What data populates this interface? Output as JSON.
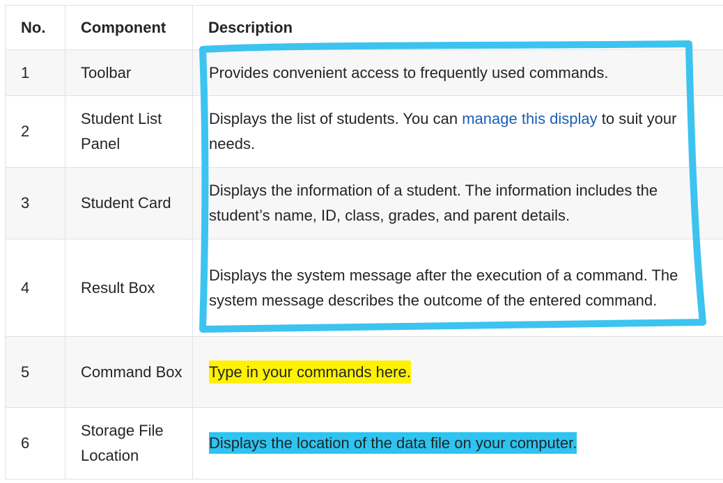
{
  "table": {
    "headers": [
      "No.",
      "Component",
      "Description"
    ],
    "rows": [
      {
        "no": "1",
        "component": "Toolbar",
        "description": "Provides convenient access to frequently used commands."
      },
      {
        "no": "2",
        "component": "Student List Panel",
        "description_before": "Displays the list of students. You can ",
        "link": "manage this display",
        "description_after": " to suit your needs."
      },
      {
        "no": "3",
        "component": "Student Card",
        "description": "Displays the information of a student. The information includes the student’s name, ID, class, grades, and parent details."
      },
      {
        "no": "4",
        "component": "Result Box",
        "description": "Displays the system message after the execution of a command. The system message describes the outcome of the entered command."
      },
      {
        "no": "5",
        "component": "Command Box",
        "description": "Type in your commands here."
      },
      {
        "no": "6",
        "component": "Storage File Location",
        "description": "Displays the location of the data file on your computer."
      }
    ]
  },
  "colors": {
    "link": "#1a5fb4",
    "highlight_yellow": "#fff200",
    "highlight_blue": "#2ec4f1",
    "annotation_box": "#3cc3f0"
  }
}
